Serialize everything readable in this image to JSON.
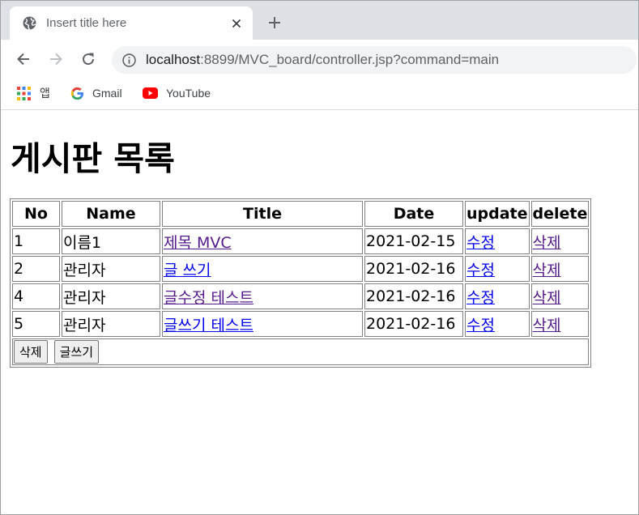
{
  "browser": {
    "tab_title": "Insert title here",
    "url_host": "localhost",
    "url_rest": ":8899/MVC_board/controller.jsp?command=main",
    "bookmarks": [
      {
        "label": "앱",
        "icon": "apps-grid-icon"
      },
      {
        "label": "Gmail",
        "icon": "google-icon"
      },
      {
        "label": "YouTube",
        "icon": "youtube-icon"
      }
    ]
  },
  "page": {
    "heading": "게시판 목록",
    "table": {
      "headers": [
        "No",
        "Name",
        "Title",
        "Date",
        "update",
        "delete"
      ],
      "rows": [
        {
          "no": "1",
          "name": "이름1",
          "title": "제목 MVC",
          "date": "2021-02-15",
          "update": "수정",
          "delete": "삭제"
        },
        {
          "no": "2",
          "name": "관리자",
          "title": "글 쓰기",
          "date": "2021-02-16",
          "update": "수정",
          "delete": "삭제"
        },
        {
          "no": "4",
          "name": "관리자",
          "title": "글수정 테스트",
          "date": "2021-02-16",
          "update": "수정",
          "delete": "삭제"
        },
        {
          "no": "5",
          "name": "관리자",
          "title": "글쓰기 테스트",
          "date": "2021-02-16",
          "update": "수정",
          "delete": "삭제"
        }
      ]
    },
    "buttons": {
      "delete": "삭제",
      "write": "글쓰기"
    }
  },
  "colors": {
    "link": "#0000ee",
    "visited_link": "#551a8b",
    "tabstrip": "#dee1e6"
  }
}
